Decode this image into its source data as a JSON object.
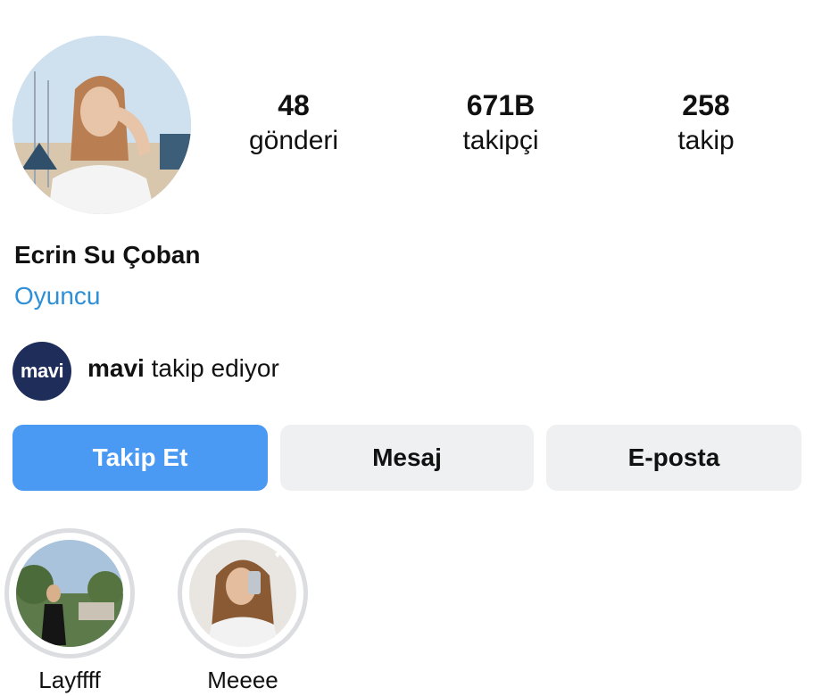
{
  "profile": {
    "name": "Ecrin Su Çoban",
    "category": "Oyuncu",
    "avatar_icon": "profile-photo"
  },
  "stats": {
    "posts": {
      "value": "48",
      "label": "gönderi"
    },
    "followers": {
      "value": "671B",
      "label": "takipçi"
    },
    "following": {
      "value": "258",
      "label": "takip"
    }
  },
  "mutual": {
    "logo_text": "mavi",
    "account": "mavi",
    "text": " takip ediyor"
  },
  "actions": {
    "follow": "Takip Et",
    "message": "Mesaj",
    "email": "E-posta"
  },
  "highlights": [
    {
      "label": "Layffff"
    },
    {
      "label": "Meeee"
    }
  ],
  "colors": {
    "accent": "#4a99f3",
    "link": "#2f8fd6",
    "button_bg": "#eff0f2"
  }
}
